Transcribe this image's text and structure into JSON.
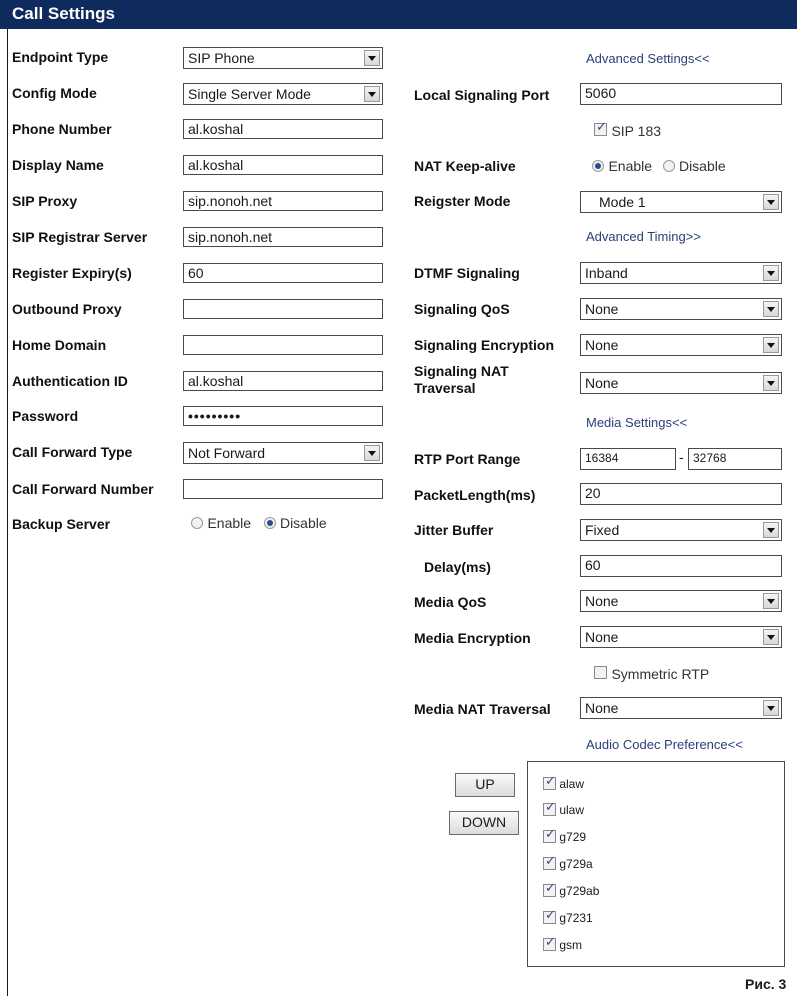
{
  "header": {
    "title": "Call Settings"
  },
  "left": {
    "endpoint_type": {
      "label": "Endpoint Type",
      "value": "SIP Phone"
    },
    "config_mode": {
      "label": "Config Mode",
      "value": "Single Server Mode"
    },
    "phone_number": {
      "label": "Phone Number",
      "value": "al.koshal"
    },
    "display_name": {
      "label": "Display Name",
      "value": "al.koshal"
    },
    "sip_proxy": {
      "label": "SIP Proxy",
      "value": "sip.nonoh.net"
    },
    "sip_registrar": {
      "label": "SIP Registrar Server",
      "value": "sip.nonoh.net"
    },
    "register_expiry": {
      "label": "Register Expiry(s)",
      "value": "60"
    },
    "outbound_proxy": {
      "label": "Outbound Proxy",
      "value": ""
    },
    "home_domain": {
      "label": "Home Domain",
      "value": ""
    },
    "authentication_id": {
      "label": "Authentication ID",
      "value": "al.koshal"
    },
    "password": {
      "label": "Password",
      "value": "•••••••••"
    },
    "call_forward_type": {
      "label": "Call Forward Type",
      "value": "Not Forward"
    },
    "call_forward_number": {
      "label": "Call Forward Number",
      "value": ""
    },
    "backup_server": {
      "label": "Backup Server",
      "enable": "Enable",
      "disable": "Disable",
      "selected": "Disable"
    }
  },
  "right": {
    "advanced_settings_link": "Advanced Settings<<",
    "local_signaling_port": {
      "label": "Local Signaling Port",
      "value": "5060"
    },
    "sip183": {
      "label": "SIP 183",
      "checked": true
    },
    "nat_keepalive": {
      "label": "NAT Keep-alive",
      "enable": "Enable",
      "disable": "Disable",
      "selected": "Enable"
    },
    "register_mode": {
      "label": "Reigster Mode",
      "value": "Mode 1"
    },
    "advanced_timing_link": "Advanced Timing>>",
    "dtmf_signaling": {
      "label": "DTMF Signaling",
      "value": "Inband"
    },
    "signaling_qos": {
      "label": "Signaling QoS",
      "value": "None"
    },
    "signaling_encryption": {
      "label": "Signaling Encryption",
      "value": "None"
    },
    "signaling_nat_traversal": {
      "label_line1": "Signaling NAT",
      "label_line2": "Traversal",
      "value": "None"
    },
    "media_settings_link": "Media Settings<<",
    "rtp_port_range": {
      "label": "RTP Port Range",
      "from": "16384",
      "separator": "-",
      "to": "32768"
    },
    "packet_length": {
      "label": "PacketLength(ms)",
      "value": "20"
    },
    "jitter_buffer": {
      "label": "Jitter Buffer",
      "value": "Fixed"
    },
    "delay": {
      "label": "Delay(ms)",
      "value": "60"
    },
    "media_qos": {
      "label": "Media QoS",
      "value": "None"
    },
    "media_encryption": {
      "label": "Media Encryption",
      "value": "None"
    },
    "symmetric_rtp": {
      "label": "Symmetric RTP",
      "checked": false
    },
    "media_nat_traversal": {
      "label": "Media NAT Traversal",
      "value": "None"
    },
    "audio_codec_link": "Audio Codec Preference<<",
    "up_button": "UP",
    "down_button": "DOWN",
    "codecs": [
      {
        "name": "alaw",
        "checked": true
      },
      {
        "name": "ulaw",
        "checked": true
      },
      {
        "name": "g729",
        "checked": true
      },
      {
        "name": "g729a",
        "checked": true
      },
      {
        "name": "g729ab",
        "checked": true
      },
      {
        "name": "g7231",
        "checked": true
      },
      {
        "name": "gsm",
        "checked": true
      }
    ]
  },
  "caption": "Рис. 3"
}
